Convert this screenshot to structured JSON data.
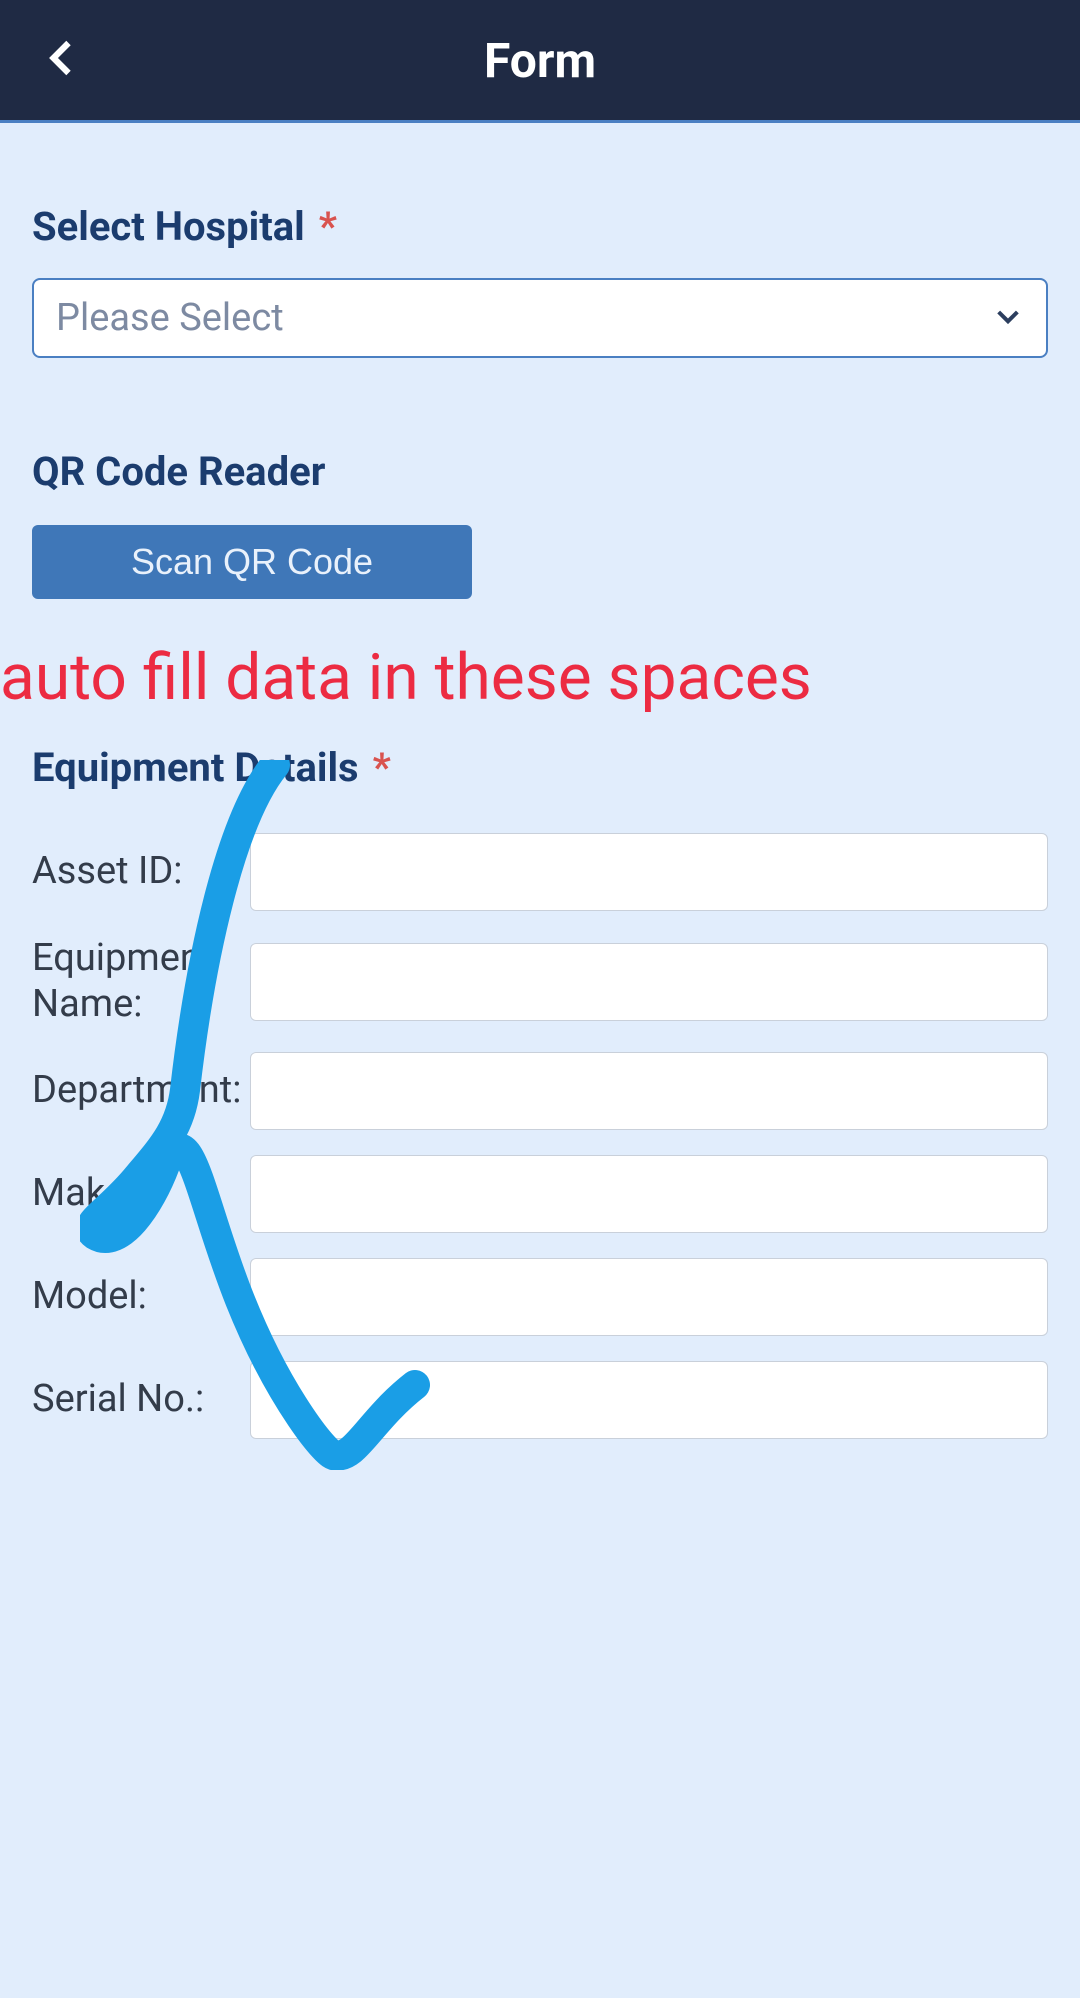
{
  "header": {
    "title": "Form"
  },
  "hospital": {
    "label": "Select Hospital",
    "placeholder": "Please Select"
  },
  "qr": {
    "label": "QR Code Reader",
    "button": "Scan QR Code"
  },
  "annotation": "auto fill data in these spaces",
  "equipment": {
    "header": "Equipment Details",
    "fields": {
      "asset_id": {
        "label": "Asset ID:",
        "value": ""
      },
      "equipment_name": {
        "label": "Equipment Name:",
        "value": ""
      },
      "department": {
        "label": "Department:",
        "value": ""
      },
      "make": {
        "label": "Make:",
        "value": ""
      },
      "model": {
        "label": "Model:",
        "value": ""
      },
      "serial_no": {
        "label": "Serial No.:",
        "value": ""
      }
    }
  },
  "colors": {
    "header_bg": "#1f2a44",
    "body_bg": "#e1edfc",
    "accent": "#3f77b8",
    "label_text": "#1b3c6e",
    "annotation": "#ec2b42",
    "scribble": "#1a9ee6"
  }
}
